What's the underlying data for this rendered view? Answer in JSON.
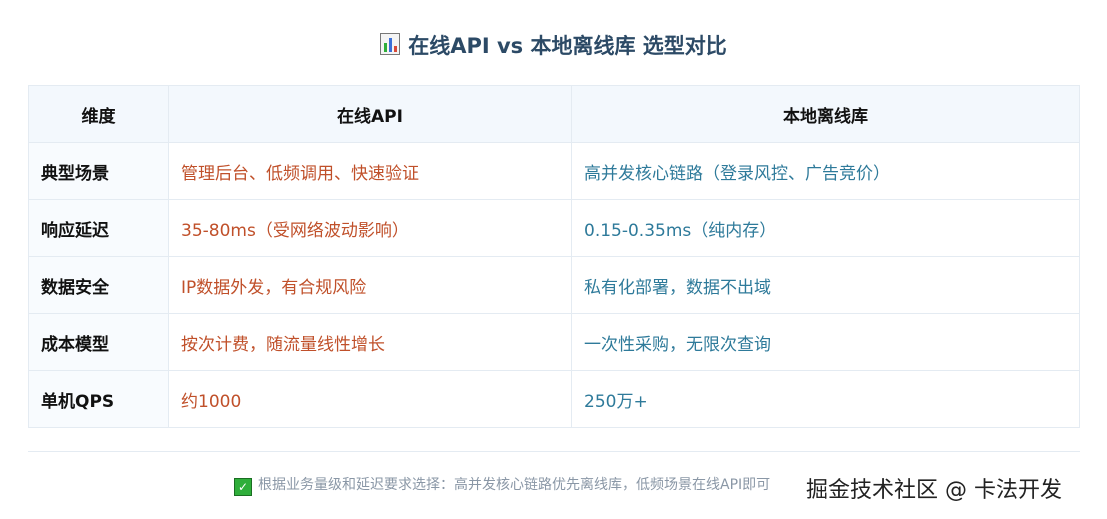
{
  "title": {
    "icon": "bar-chart-icon",
    "text": "在线API vs 本地离线库 选型对比"
  },
  "table": {
    "headers": [
      "维度",
      "在线API",
      "本地离线库"
    ],
    "rows": [
      {
        "dim": "典型场景",
        "api": "管理后台、低频调用、快速验证",
        "local": "高并发核心链路（登录风控、广告竞价）"
      },
      {
        "dim": "响应延迟",
        "api": "35-80ms（受网络波动影响）",
        "local": "0.15-0.35ms（纯内存）"
      },
      {
        "dim": "数据安全",
        "api": "IP数据外发，有合规风险",
        "local": "私有化部署，数据不出域"
      },
      {
        "dim": "成本模型",
        "api": "按次计费，随流量线性增长",
        "local": "一次性采购，无限次查询"
      },
      {
        "dim": "单机QPS",
        "api": "约1000",
        "local": "250万+"
      }
    ]
  },
  "footer": {
    "icon": "check-icon",
    "text": "根据业务量级和延迟要求选择：高并发核心链路优先离线库，低频场景在线API即可"
  },
  "watermark": "掘金技术社区 @ 卡法开发",
  "colors": {
    "title": "#2c4a66",
    "api": "#c0502a",
    "local": "#2e7a9a",
    "header_bg": "#f3f8fd"
  }
}
